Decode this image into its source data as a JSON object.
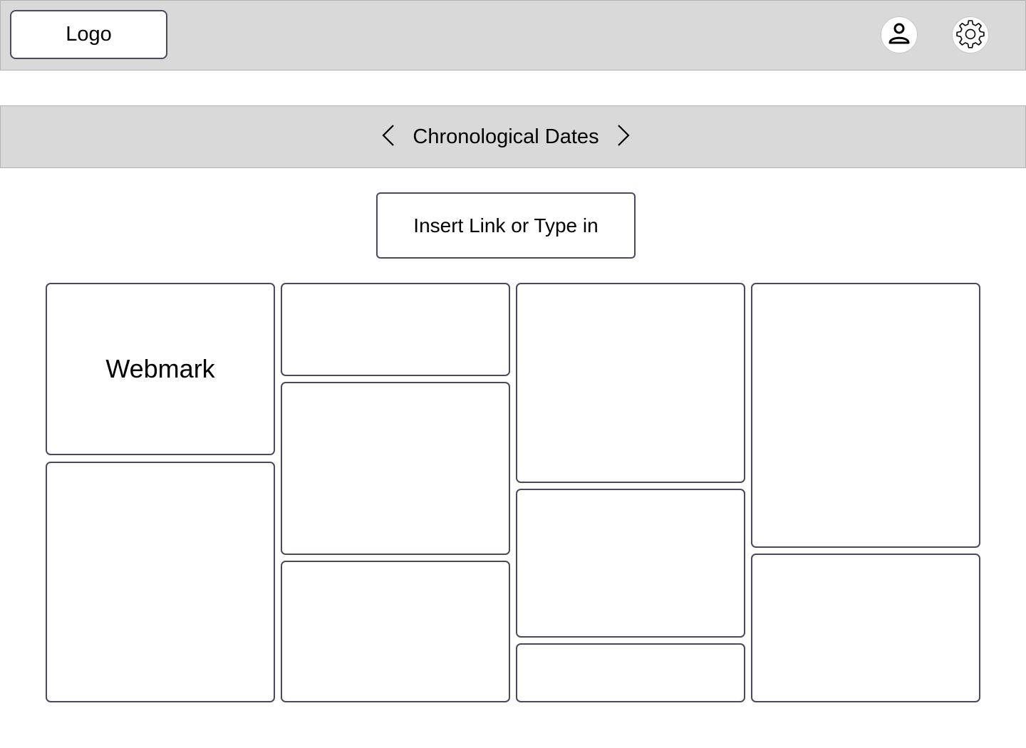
{
  "header": {
    "logo_label": "Logo",
    "user_icon": "user-icon",
    "settings_icon": "gear-icon"
  },
  "date_nav": {
    "title": "Chronological Dates",
    "prev_icon": "chevron-left-icon",
    "next_icon": "chevron-right-icon"
  },
  "insert": {
    "label": "Insert Link or Type in"
  },
  "cards": [
    {
      "label": "Webmark"
    },
    {
      "label": ""
    },
    {
      "label": ""
    },
    {
      "label": ""
    },
    {
      "label": ""
    },
    {
      "label": ""
    },
    {
      "label": ""
    },
    {
      "label": ""
    },
    {
      "label": ""
    },
    {
      "label": ""
    }
  ],
  "colors": {
    "bar_background": "#d9d9d9",
    "border": "#4a4a5a",
    "card_background": "#ffffff"
  }
}
